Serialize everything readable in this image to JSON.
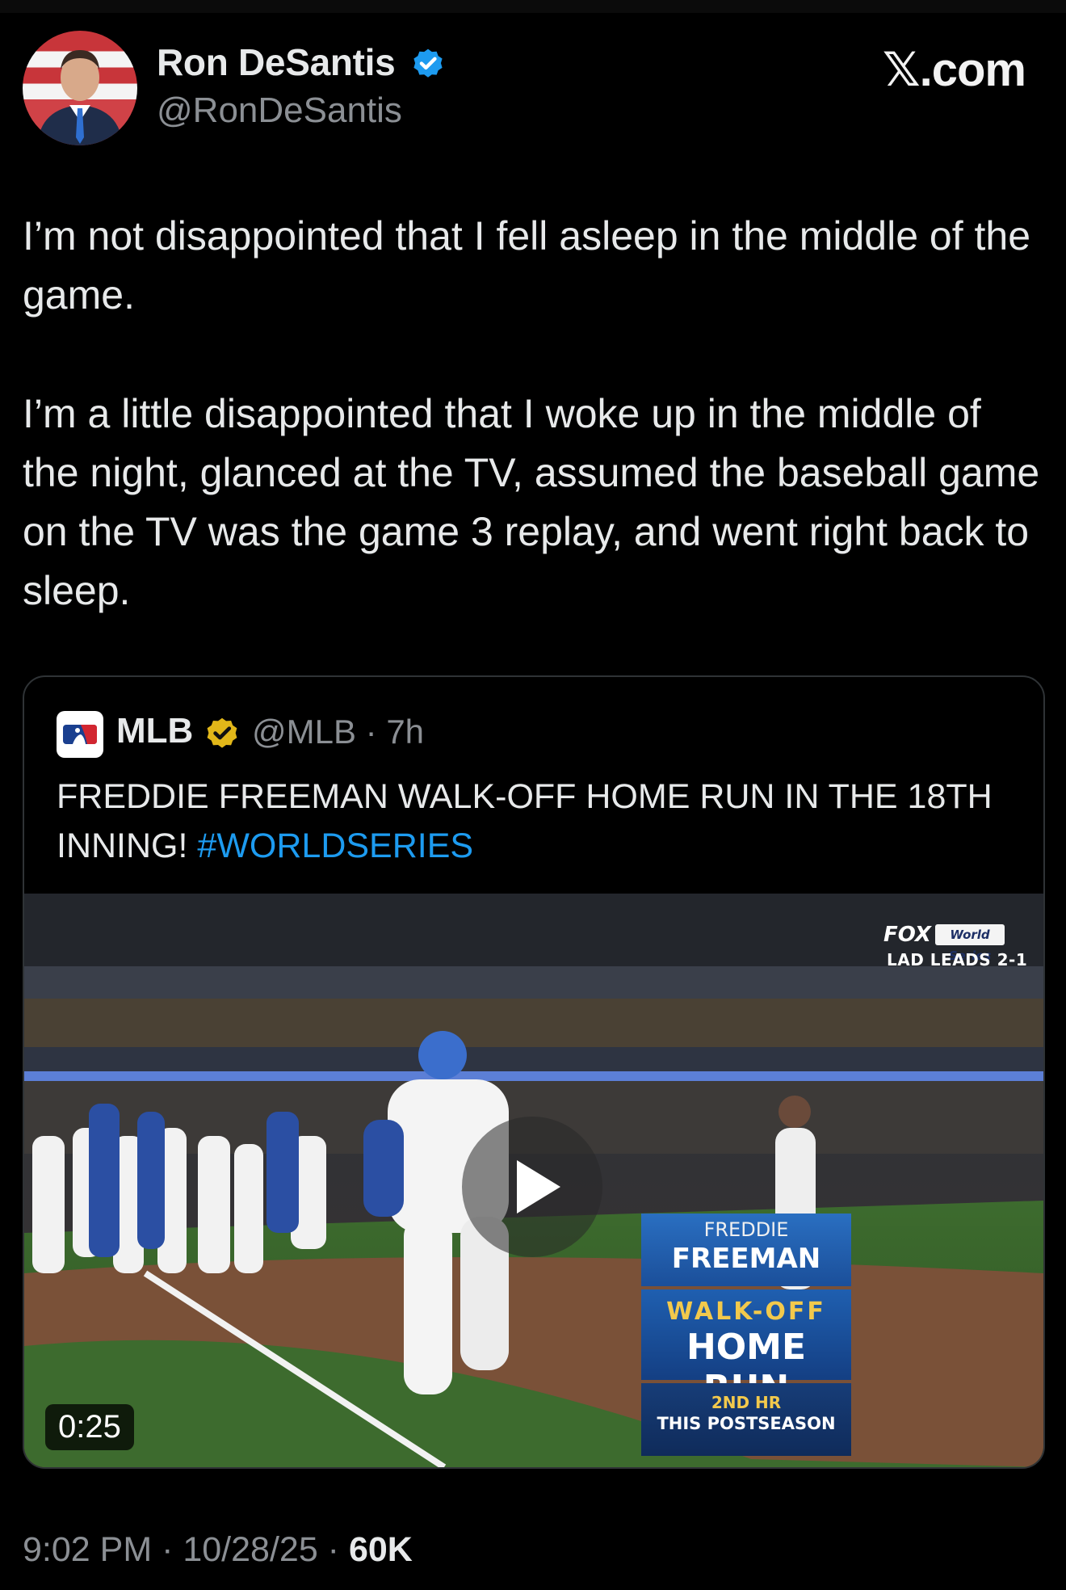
{
  "author": {
    "name": "Ron DeSantis",
    "handle": "@RonDeSantis",
    "verified_badge_color": "#1d9bf0"
  },
  "site_logo": {
    "mark": "𝕏",
    "suffix": ".com"
  },
  "tweet": {
    "paragraphs": [
      "I’m not disappointed that I fell asleep in the middle of the game.",
      "I’m a little disappointed that I woke up in the middle of the night, glanced at the TV, assumed the baseball game on the TV was the game 3 replay, and went right back to sleep."
    ]
  },
  "quoted": {
    "name": "MLB",
    "handle_time": "@MLB · 7h",
    "verified_badge_color": "#e2b719",
    "text": "FREDDIE FREEMAN WALK-OFF HOME RUN IN THE 18TH INNING! ",
    "hashtag": "#WORLDSERIES",
    "hashtag_color": "#1d9bf0",
    "video": {
      "duration": "0:25",
      "play_icon": "play-icon",
      "broadcast": {
        "network": "FOX",
        "series_logo": "World Series",
        "score": "LAD LEADS 2-1"
      },
      "graphic": {
        "first_name": "FREDDIE",
        "last_name": "FREEMAN",
        "headline_1": "WALK-OFF",
        "headline_2": "HOME RUN",
        "stat_ordinal": "2ND HR",
        "stat_context": "THIS POSTSEASON"
      }
    }
  },
  "footer": {
    "timestamp": "9:02 PM · 10/28/25 · ",
    "views": "60K"
  }
}
